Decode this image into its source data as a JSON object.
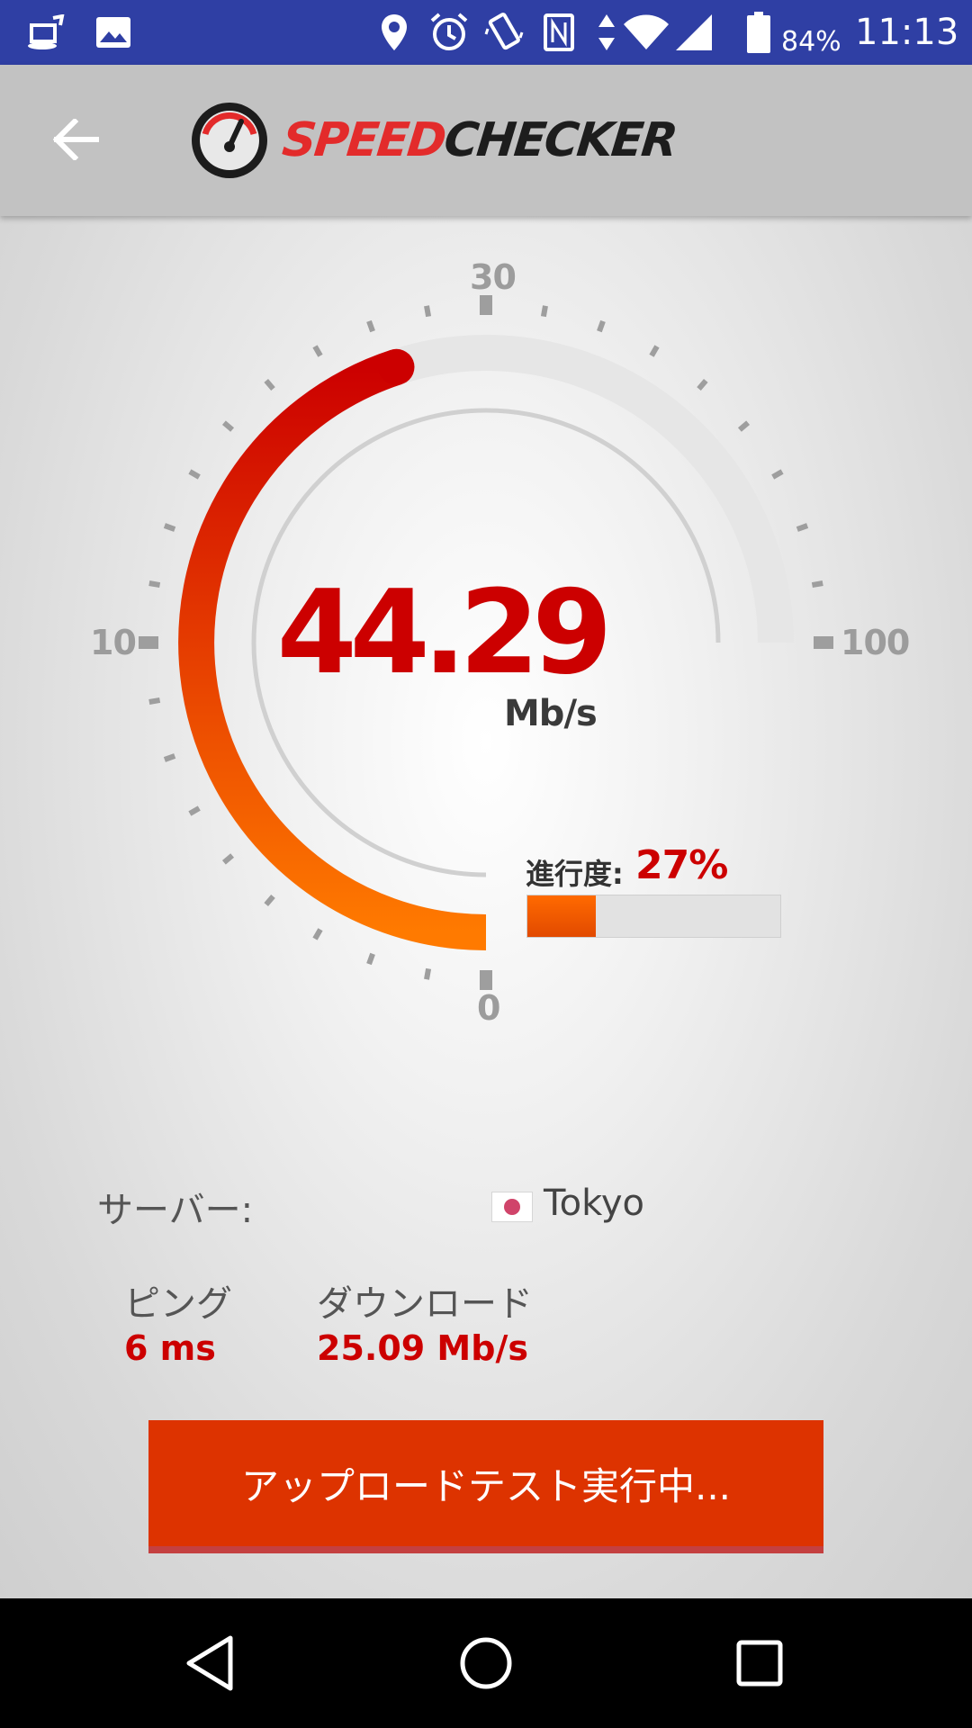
{
  "status_bar": {
    "battery": "84%",
    "time": "11:13",
    "icons": [
      "notification-app-icon",
      "image-icon",
      "location-icon",
      "alarm-icon",
      "vibrate-icon",
      "nfc-icon",
      "data-arrows-icon",
      "wifi-icon",
      "signal-icon",
      "battery-icon"
    ]
  },
  "app_bar": {
    "logo_part1": "SPEED",
    "logo_part2": "CHECKER"
  },
  "gauge": {
    "labels": {
      "top": "30",
      "left": "10",
      "right": "100",
      "bottom": "0"
    },
    "speed": "44.29",
    "unit": "Mb/s",
    "fill_fraction": 0.6,
    "colors": {
      "start": "#ff7a00",
      "end": "#cc0000",
      "track": "#e6e6e6"
    }
  },
  "progress": {
    "label": "進行度:",
    "value_text": "27%",
    "value": 27
  },
  "server": {
    "label": "サーバー:",
    "value": "Tokyo"
  },
  "metrics": {
    "ping_label": "ピング",
    "ping_value": "6 ms",
    "download_label": "ダウンロード",
    "download_value": "25.09 Mb/s"
  },
  "upload_button": {
    "label": "アップロードテスト実行中..."
  },
  "nav": {
    "icons": [
      "back-nav-icon",
      "home-nav-icon",
      "recents-nav-icon"
    ]
  }
}
